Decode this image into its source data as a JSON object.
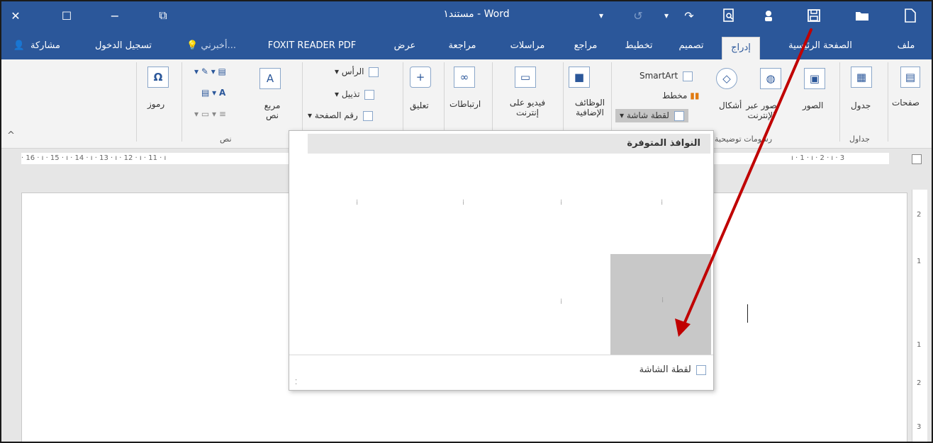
{
  "window": {
    "title": "مستند١ - Word",
    "controls": {
      "close": "✕",
      "maximize": "☐",
      "minimize": "−",
      "restore": "⧉"
    },
    "quick_access": {
      "dropdown": "▾",
      "undo": "↺",
      "redo": "↷"
    }
  },
  "tabs": [
    {
      "label": "ملف"
    },
    {
      "label": "الصفحة الرئيسية"
    },
    {
      "label": "إدراج"
    },
    {
      "label": "تصميم"
    },
    {
      "label": "تخطيط"
    },
    {
      "label": "مراجع"
    },
    {
      "label": "مراسلات"
    },
    {
      "label": "مراجعة"
    },
    {
      "label": "عرض"
    },
    {
      "label": "FOXIT READER PDF"
    },
    {
      "label": "أخبرني..."
    }
  ],
  "account": {
    "signin": "تسجيل الدخول",
    "share": "مشاركة"
  },
  "ribbon": {
    "pages": "صفحات",
    "table": "جدول",
    "tables_group": "جداول",
    "pictures": "الصور",
    "online_pictures": "صور عبر الإنترنت",
    "shapes": "أشكال",
    "smartart": "SmartArt",
    "chart": "مخطط",
    "screenshot": "لقطة شاشة",
    "illustrations_group": "رسومات توضيحية",
    "addins": "الوظائف الإضافية",
    "online_video": "فيديو على إنترنت",
    "links": "ارتباطات",
    "comment": "تعليق",
    "header": "الرأس",
    "footer": "تذييل",
    "page_number": "رقم الصفحة",
    "text_box": "مربع نص",
    "text_group": "نص",
    "symbols": "رموز"
  },
  "ruler": {
    "ticks": "· 16 · ı · 15 · ı · 14 · ı · 13 · ı · 12 · ı · 11 · ı",
    "ticks_right": "ı · 1 · ı · 2 · ı · 3",
    "vertical": [
      "2",
      "1",
      "1",
      "2",
      "3"
    ]
  },
  "dropdown": {
    "header": "النوافذ المتوفرة",
    "footer": "لقطة الشاشة"
  },
  "colors": {
    "brand": "#2b579a",
    "arrow": "#c00000"
  }
}
